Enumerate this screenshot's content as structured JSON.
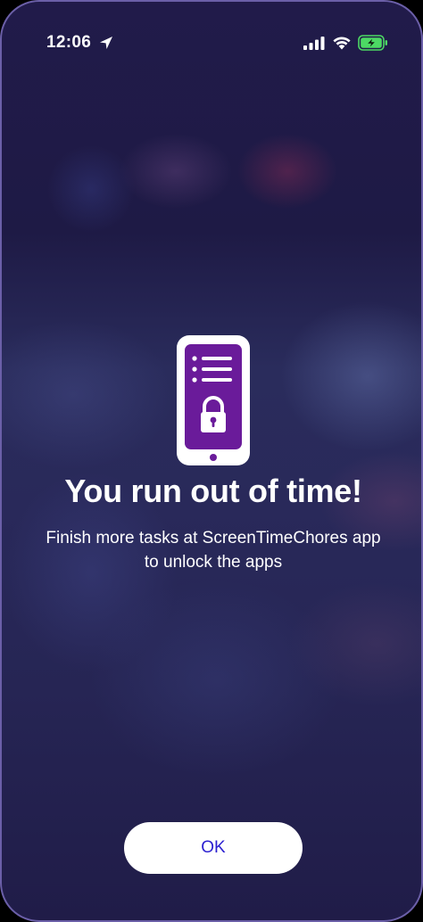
{
  "status_bar": {
    "time": "12:06",
    "icons": [
      "location-arrow-icon",
      "cellular-signal-icon",
      "wifi-icon",
      "battery-charging-icon"
    ],
    "battery_color": "#4cd964"
  },
  "illustration": {
    "icon": "locked-phone-icon",
    "accent_color": "#6a1b9a"
  },
  "message": {
    "title": "You run out of time!",
    "line1": "Finish more tasks at ScreenTimeChores app",
    "line2": "to unlock the apps"
  },
  "actions": {
    "ok_label": "OK",
    "ok_text_color": "#2b1fd0"
  }
}
